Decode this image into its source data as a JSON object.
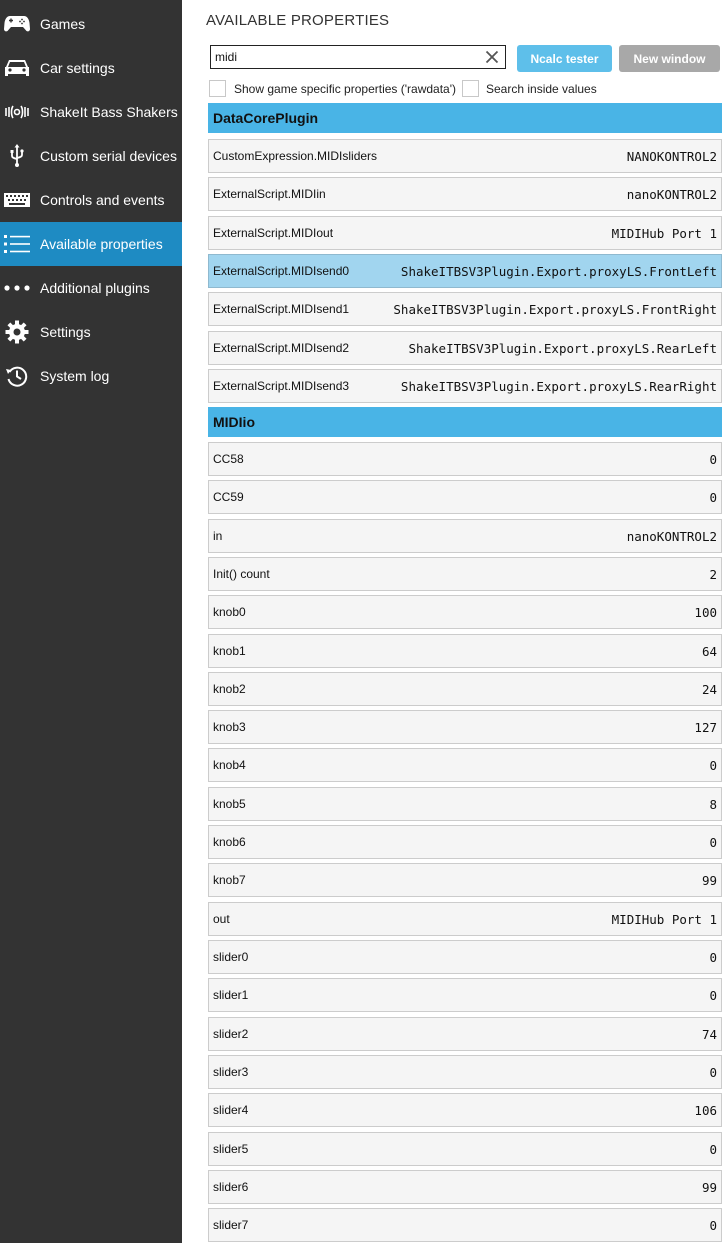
{
  "sidebar": {
    "items": [
      {
        "label": "Games",
        "icon": "gamepad-icon",
        "active": false
      },
      {
        "label": "Car settings",
        "icon": "car-icon",
        "active": false
      },
      {
        "label": "ShakeIt Bass Shakers",
        "icon": "vibration-icon",
        "active": false
      },
      {
        "label": "Custom serial devices",
        "icon": "usb-icon",
        "active": false
      },
      {
        "label": "Controls and events",
        "icon": "keyboard-icon",
        "active": false
      },
      {
        "label": "Available properties",
        "icon": "list-icon",
        "active": true
      },
      {
        "label": "Additional plugins",
        "icon": "more-dots-icon",
        "active": false
      },
      {
        "label": "Settings",
        "icon": "gear-icon",
        "active": false
      },
      {
        "label": "System log",
        "icon": "history-icon",
        "active": false
      }
    ]
  },
  "header": {
    "title": "AVAILABLE PROPERTIES"
  },
  "search": {
    "value": "midi",
    "placeholder": ""
  },
  "toolbar": {
    "ncalc_label": "Ncalc tester",
    "new_window_label": "New window"
  },
  "options": {
    "show_game_specific_label": "Show game specific properties ('rawdata')",
    "show_game_specific_checked": false,
    "search_inside_values_label": "Search inside values",
    "search_inside_values_checked": false
  },
  "colors": {
    "sidebar_bg": "#333333",
    "active_nav": "#1e8bc3",
    "group_header": "#49b4e6",
    "ncalc_button": "#5ebfea",
    "new_window_button": "#a8a8a8",
    "selected_row": "#a1d5ef",
    "row_bg": "#f5f5f5"
  },
  "groups": [
    {
      "name": "DataCorePlugin",
      "rows": [
        {
          "name": "CustomExpression.MIDIsliders",
          "value": "NANOKONTROL2",
          "selected": false
        },
        {
          "name": "ExternalScript.MIDIin",
          "value": "nanoKONTROL2",
          "selected": false
        },
        {
          "name": "ExternalScript.MIDIout",
          "value": "MIDIHub Port 1",
          "selected": false
        },
        {
          "name": "ExternalScript.MIDIsend0",
          "value": "ShakeITBSV3Plugin.Export.proxyLS.FrontLeft",
          "selected": true
        },
        {
          "name": "ExternalScript.MIDIsend1",
          "value": "ShakeITBSV3Plugin.Export.proxyLS.FrontRight",
          "selected": false
        },
        {
          "name": "ExternalScript.MIDIsend2",
          "value": "ShakeITBSV3Plugin.Export.proxyLS.RearLeft",
          "selected": false
        },
        {
          "name": "ExternalScript.MIDIsend3",
          "value": "ShakeITBSV3Plugin.Export.proxyLS.RearRight",
          "selected": false
        }
      ]
    },
    {
      "name": "MIDIio",
      "rows": [
        {
          "name": "CC58",
          "value": "0",
          "selected": false
        },
        {
          "name": "CC59",
          "value": "0",
          "selected": false
        },
        {
          "name": "in",
          "value": "nanoKONTROL2",
          "selected": false
        },
        {
          "name": "Init() count",
          "value": "2",
          "selected": false
        },
        {
          "name": "knob0",
          "value": "100",
          "selected": false
        },
        {
          "name": "knob1",
          "value": "64",
          "selected": false
        },
        {
          "name": "knob2",
          "value": "24",
          "selected": false
        },
        {
          "name": "knob3",
          "value": "127",
          "selected": false
        },
        {
          "name": "knob4",
          "value": "0",
          "selected": false
        },
        {
          "name": "knob5",
          "value": "8",
          "selected": false
        },
        {
          "name": "knob6",
          "value": "0",
          "selected": false
        },
        {
          "name": "knob7",
          "value": "99",
          "selected": false
        },
        {
          "name": "out",
          "value": "MIDIHub Port 1",
          "selected": false
        },
        {
          "name": "slider0",
          "value": "0",
          "selected": false
        },
        {
          "name": "slider1",
          "value": "0",
          "selected": false
        },
        {
          "name": "slider2",
          "value": "74",
          "selected": false
        },
        {
          "name": "slider3",
          "value": "0",
          "selected": false
        },
        {
          "name": "slider4",
          "value": "106",
          "selected": false
        },
        {
          "name": "slider5",
          "value": "0",
          "selected": false
        },
        {
          "name": "slider6",
          "value": "99",
          "selected": false
        },
        {
          "name": "slider7",
          "value": "0",
          "selected": false
        }
      ]
    }
  ]
}
